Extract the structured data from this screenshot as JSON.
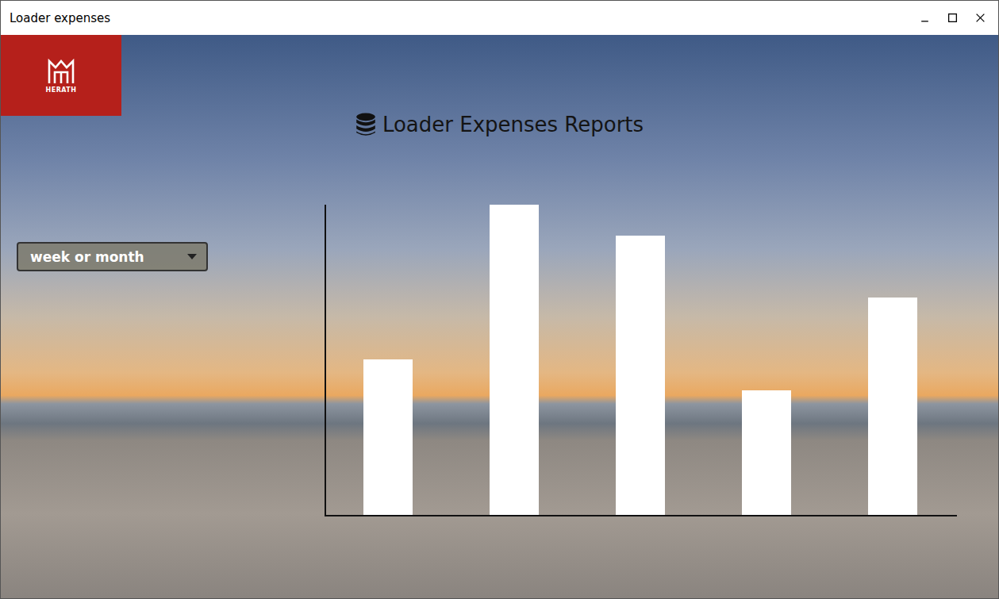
{
  "window": {
    "title": "Loader expenses"
  },
  "logo": {
    "text": "HERATH"
  },
  "title": "Loader Expenses Reports",
  "filter": {
    "value": "week or month",
    "expanded": false
  },
  "chart": {
    "series": [
      {
        "values": [
          197,
          393,
          354,
          158,
          275
        ]
      }
    ]
  }
}
